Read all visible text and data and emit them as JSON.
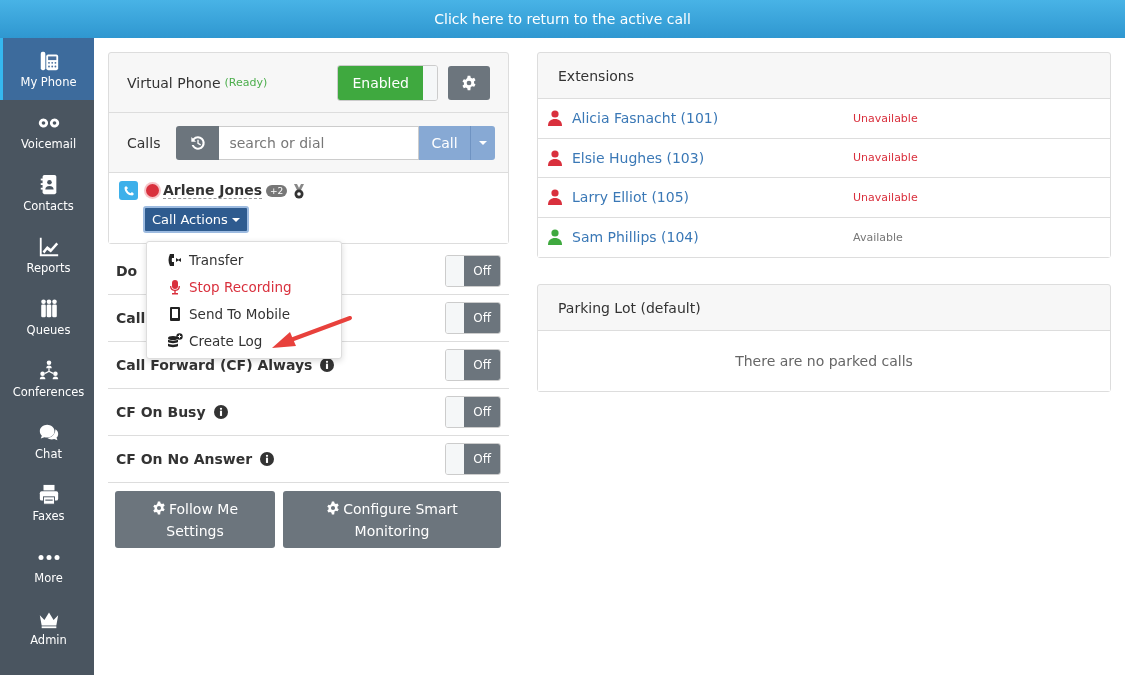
{
  "banner": {
    "text": "Click here to return to the active call"
  },
  "sidebar": {
    "items": [
      {
        "label": "My Phone",
        "selected": true
      },
      {
        "label": "Voicemail",
        "selected": false
      },
      {
        "label": "Contacts",
        "selected": false
      },
      {
        "label": "Reports",
        "selected": false
      },
      {
        "label": "Queues",
        "selected": false
      },
      {
        "label": "Conferences",
        "selected": false
      },
      {
        "label": "Chat",
        "selected": false
      },
      {
        "label": "Faxes",
        "selected": false
      },
      {
        "label": "More",
        "selected": false
      },
      {
        "label": "Admin",
        "selected": false
      }
    ]
  },
  "virtual_phone": {
    "title": "Virtual Phone",
    "status": "(Ready)",
    "toggle": {
      "label": "Enabled",
      "on": true
    }
  },
  "calls": {
    "label": "Calls",
    "search": {
      "placeholder": "search or dial"
    },
    "call_button": "Call"
  },
  "active_call": {
    "name": "Arlene Jones",
    "badge": "+2",
    "recording": true,
    "actions_button": "Call Actions"
  },
  "call_actions_menu": {
    "items": [
      {
        "label": "Transfer",
        "danger": false
      },
      {
        "label": "Stop Recording",
        "danger": true
      },
      {
        "label": "Send To Mobile",
        "danger": false
      },
      {
        "label": "Create Log",
        "danger": false
      }
    ]
  },
  "settings": [
    {
      "label": "Do",
      "info": false,
      "toggle": {
        "label": "Off",
        "on": false
      }
    },
    {
      "label": "Call",
      "info": false,
      "toggle": {
        "label": "Off",
        "on": false
      }
    },
    {
      "label": "Call Forward (CF) Always",
      "info": true,
      "toggle": {
        "label": "Off",
        "on": false
      }
    },
    {
      "label": "CF On Busy",
      "info": true,
      "toggle": {
        "label": "Off",
        "on": false
      }
    },
    {
      "label": "CF On No Answer",
      "info": true,
      "toggle": {
        "label": "Off",
        "on": false
      }
    }
  ],
  "buttons": [
    "Follow Me Settings",
    "Configure Smart Monitoring"
  ],
  "extensions": {
    "title": "Extensions",
    "rows": [
      {
        "name": "Alicia Fasnacht (101)",
        "status": "Unavailable",
        "available": false
      },
      {
        "name": "Elsie Hughes (103)",
        "status": "Unavailable",
        "available": false
      },
      {
        "name": "Larry Elliot (105)",
        "status": "Unavailable",
        "available": false
      },
      {
        "name": "Sam Phillips (104)",
        "status": "Available",
        "available": true
      }
    ]
  },
  "parking_lot": {
    "title": "Parking Lot (default)",
    "empty_text": "There are no parked calls"
  }
}
